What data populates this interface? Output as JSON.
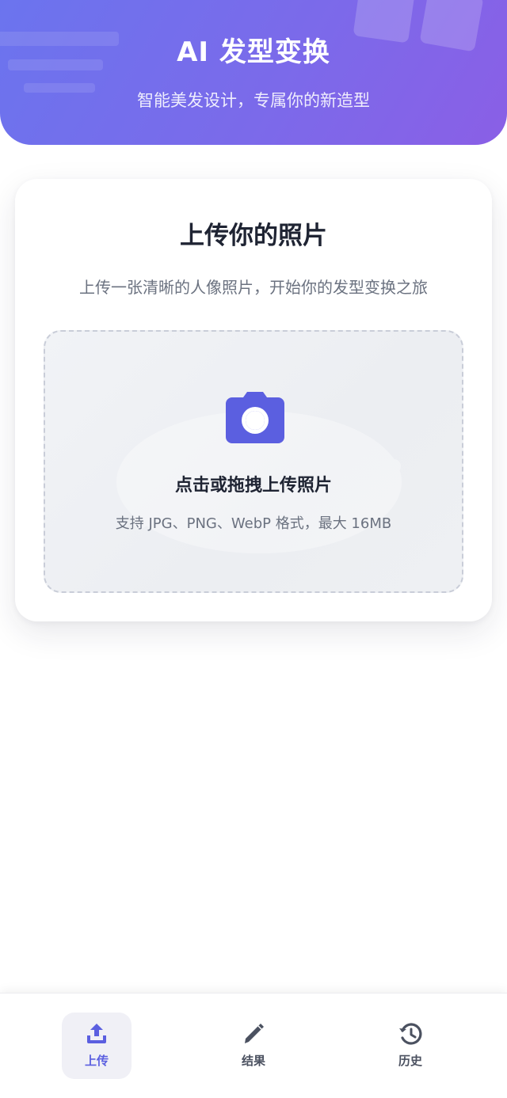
{
  "header": {
    "title": "AI 发型变换",
    "subtitle": "智能美发设计，专属你的新造型"
  },
  "upload_card": {
    "title": "上传你的照片",
    "description": "上传一张清晰的人像照片，开始你的发型变换之旅",
    "dropzone": {
      "icon": "camera-icon",
      "title": "点击或拖拽上传照片",
      "hint": "支持 JPG、PNG、WebP 格式，最大 16MB"
    }
  },
  "bottom_nav": {
    "items": [
      {
        "label": "上传",
        "icon": "upload-icon",
        "active": true
      },
      {
        "label": "结果",
        "icon": "brush-icon",
        "active": false
      },
      {
        "label": "历史",
        "icon": "history-icon",
        "active": false
      }
    ]
  },
  "colors": {
    "header_gradient_start": "#6b74ee",
    "header_gradient_end": "#8a5fe6",
    "accent": "#5b5fe0",
    "text_primary": "#1f2433",
    "text_secondary": "#6b7280"
  }
}
